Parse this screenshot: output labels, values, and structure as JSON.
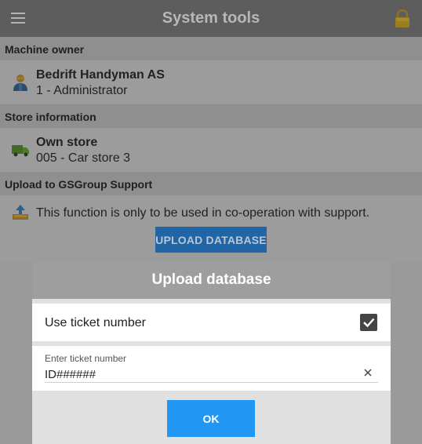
{
  "topbar": {
    "title": "System tools",
    "menu_icon": "hamburger-menu-icon",
    "lock_icon": "lock-icon"
  },
  "sections": {
    "owner": {
      "header": "Machine owner",
      "name": "Bedrift Handyman AS",
      "role": "1 - Administrator",
      "icon": "user-icon"
    },
    "store": {
      "header": "Store information",
      "name": "Own store",
      "detail": "005 - Car store 3",
      "icon": "truck-icon"
    },
    "upload": {
      "header": "Upload to GSGroup Support",
      "text": "This function is only to be used in co-operation with support.",
      "button_label": "UPLOAD DATABASE",
      "icon": "upload-icon"
    }
  },
  "dialog": {
    "title": "Upload database",
    "use_ticket_label": "Use ticket number",
    "use_ticket_checked": true,
    "ticket_field_label": "Enter ticket number",
    "ticket_value": "ID######",
    "ok_label": "OK"
  },
  "colors": {
    "accent_blue": "#2196f3",
    "dimmed_button_blue": "#2066a6",
    "overlay_gray": "#9a9a9a"
  }
}
